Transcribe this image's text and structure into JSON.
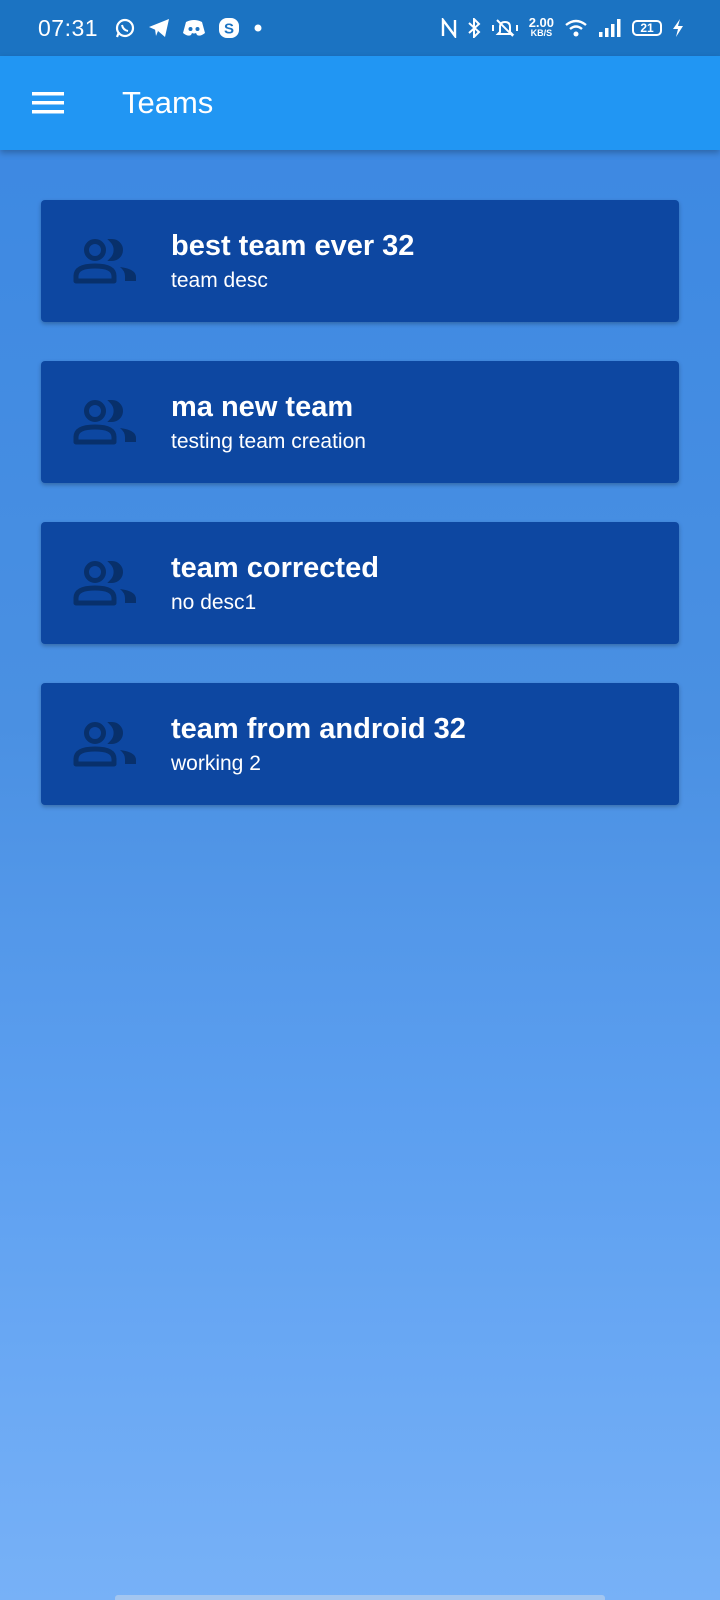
{
  "status_bar": {
    "time": "07:31",
    "speed_value": "2.00",
    "speed_unit": "KB/S",
    "battery": "21",
    "left_icons": [
      "whatsapp-icon",
      "telegram-icon",
      "discord-icon",
      "skype-icon",
      "dot-icon"
    ],
    "right_icons": [
      "nfc-icon",
      "bluetooth-icon",
      "vibrate-icon",
      "wifi-icon",
      "signal-icon",
      "charging-icon"
    ]
  },
  "app_bar": {
    "title": "Teams",
    "menu_icon": "menu-icon"
  },
  "teams": [
    {
      "name": "best team ever 32",
      "description": "team desc",
      "icon": "group-icon"
    },
    {
      "name": "ma new team",
      "description": "testing team creation",
      "icon": "group-icon"
    },
    {
      "name": "team corrected",
      "description": "no desc1",
      "icon": "group-icon"
    },
    {
      "name": "team from android 32",
      "description": "working 2",
      "icon": "group-icon"
    }
  ],
  "colors": {
    "status_bar": "#1b73c2",
    "app_bar": "#2196f3",
    "card": "#0d47a1",
    "card_icon": "#08306b"
  }
}
